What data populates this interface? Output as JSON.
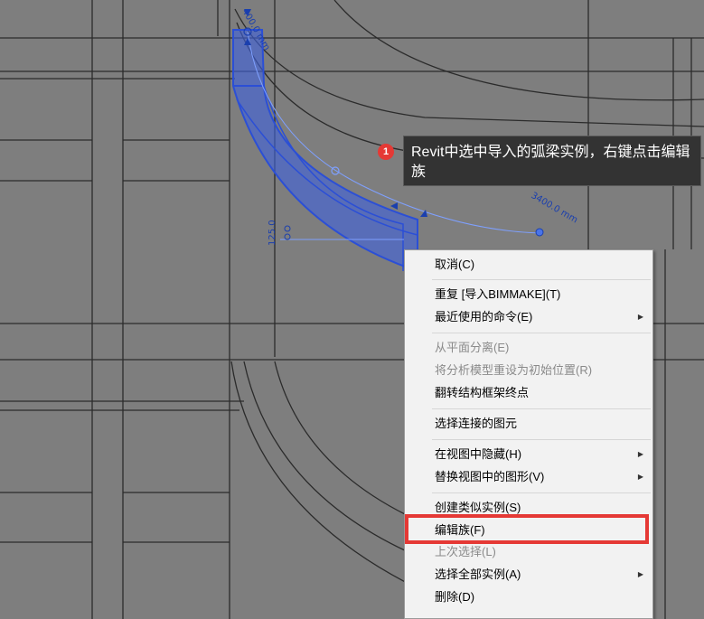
{
  "tooltip": {
    "step_number": "1",
    "text": "Revit中选中导入的弧梁实例，右键点击编辑族"
  },
  "dimensions": {
    "top_label": "400.0 mm",
    "right_label": "3400.0 mm",
    "left_label": "125.0"
  },
  "context_menu": {
    "items": [
      {
        "label": "取消(C)",
        "enabled": true,
        "submenu": false
      },
      {
        "label": "重复 [导入BIMMAKE](T)",
        "enabled": true,
        "submenu": false
      },
      {
        "label": "最近使用的命令(E)",
        "enabled": true,
        "submenu": true
      },
      {
        "label": "从平面分离(E)",
        "enabled": false,
        "submenu": false
      },
      {
        "label": "将分析模型重设为初始位置(R)",
        "enabled": false,
        "submenu": false
      },
      {
        "label": "翻转结构框架终点",
        "enabled": true,
        "submenu": false
      },
      {
        "label": "选择连接的图元",
        "enabled": true,
        "submenu": false
      },
      {
        "label": "在视图中隐藏(H)",
        "enabled": true,
        "submenu": true
      },
      {
        "label": "替换视图中的图形(V)",
        "enabled": true,
        "submenu": true
      },
      {
        "label": "创建类似实例(S)",
        "enabled": true,
        "submenu": false
      },
      {
        "label": "编辑族(F)",
        "enabled": true,
        "submenu": false
      },
      {
        "label": "上次选择(L)",
        "enabled": false,
        "submenu": false
      },
      {
        "label": "选择全部实例(A)",
        "enabled": true,
        "submenu": true
      },
      {
        "label": "删除(D)",
        "enabled": true,
        "submenu": false
      }
    ]
  },
  "colors": {
    "canvas_bg": "#7e7e7e",
    "selection_blue": "#2b4fd6",
    "highlight_red": "#e53935"
  }
}
